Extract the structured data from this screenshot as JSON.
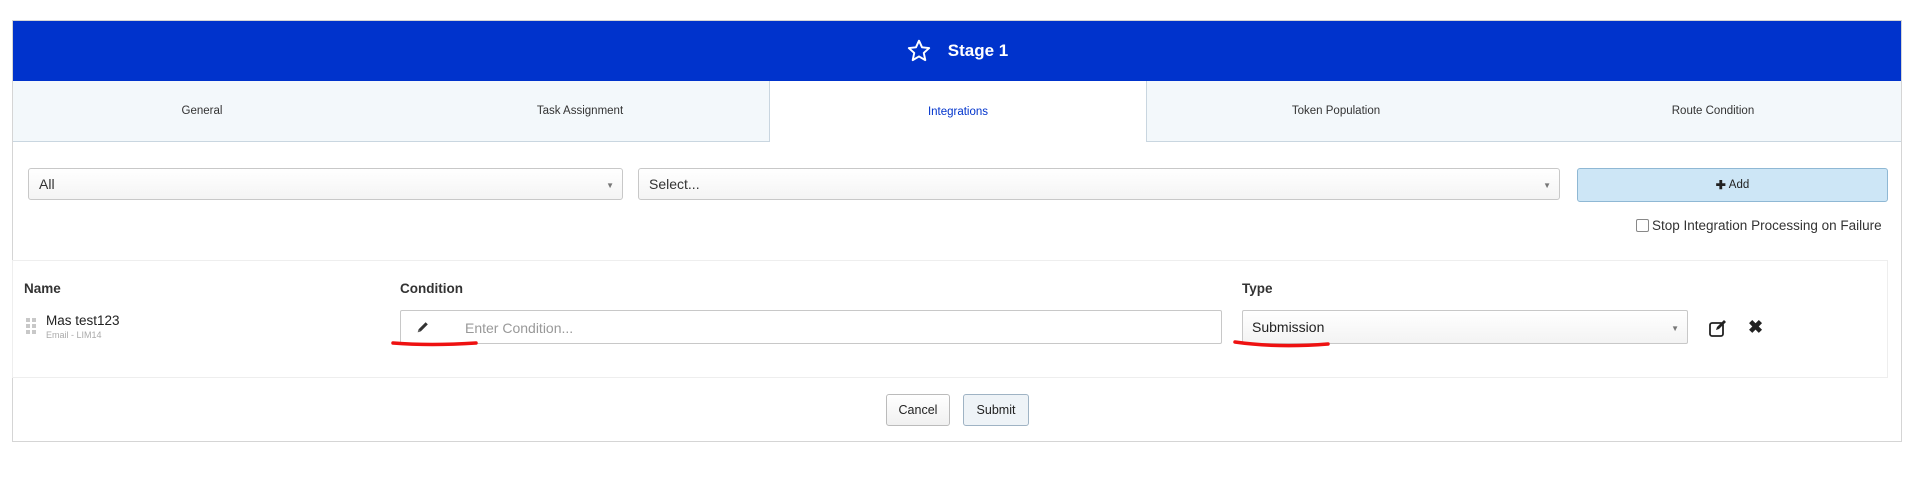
{
  "header": {
    "title": "Stage 1",
    "icon": "star-icon",
    "color": "#0033cc"
  },
  "tabs": [
    {
      "label": "General",
      "active": false
    },
    {
      "label": "Task Assignment",
      "active": false
    },
    {
      "label": "Integrations",
      "active": true
    },
    {
      "label": "Token Population",
      "active": false
    },
    {
      "label": "Route Condition",
      "active": false
    }
  ],
  "filters": {
    "category_value": "All",
    "integration_value": "Select...",
    "add_label": "Add"
  },
  "options": {
    "stop_label": "Stop Integration Processing on Failure",
    "stop_checked": false
  },
  "table": {
    "columns": {
      "name": "Name",
      "condition": "Condition",
      "type": "Type"
    },
    "rows": [
      {
        "name": "Mas test123",
        "subtitle": "Email - LIM14",
        "condition_placeholder": "Enter Condition...",
        "condition_value": "",
        "type_value": "Submission"
      }
    ]
  },
  "footer": {
    "cancel_label": "Cancel",
    "submit_label": "Submit"
  },
  "annotation_color": "#ee1111"
}
